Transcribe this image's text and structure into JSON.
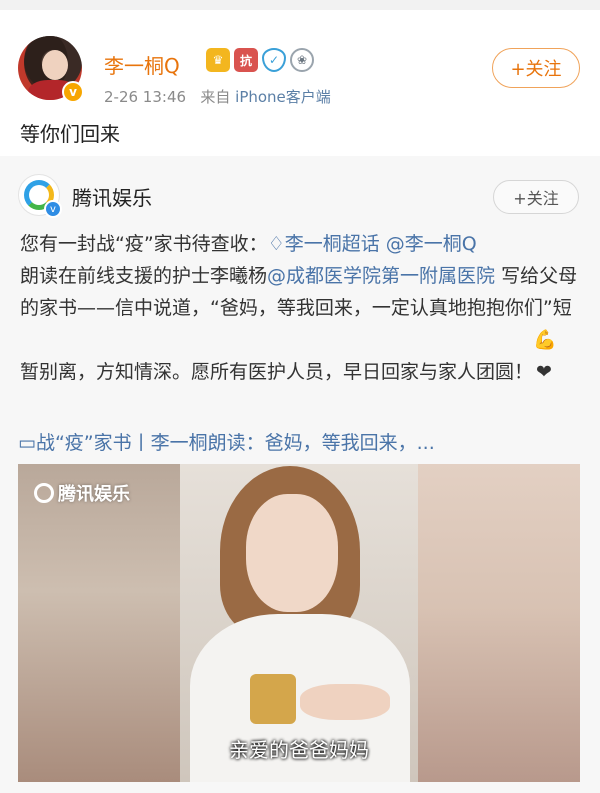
{
  "post": {
    "author": "李一桐Q",
    "badges": [
      "crown-vip-icon",
      "fight-badge-icon",
      "shield-badge-icon",
      "medal-badge-icon"
    ],
    "badge_fight_text": "抗",
    "verified_mark": "v",
    "time": "2-26 13:46",
    "source_prefix": "来自",
    "source": "iPhone客户端",
    "follow_label": "+关注",
    "text": "等你们回来"
  },
  "repost": {
    "author": "腾讯娱乐",
    "verified_mark": "v",
    "follow_label": "+关注",
    "body": {
      "part1": "您有一封战“疫”家书待查收：",
      "link_topic": "♢李一桐超话",
      "link_mention1": "@李一桐Q",
      "part2": "朗读在前线支援的护士李曦杨",
      "link_mention2": "@成都医学院第一附属医院",
      "part3": "写给父母的家书——信中说道，“爸妈，等我回来，一定认真地抱抱你们”短暂别离，方知情深。愿所有医护人员，早日回家与家人团圆！",
      "emoji": "💪❤"
    },
    "video_title": "▭战“疫”家书丨李一桐朗读：爸妈，等我回来，...",
    "video": {
      "watermark": "腾讯娱乐",
      "subtitle": "亲爱的爸爸妈妈"
    }
  },
  "colors": {
    "author_orange": "#e8740c",
    "link_blue": "#4a74a8",
    "card_bg": "#f7f7f7"
  }
}
